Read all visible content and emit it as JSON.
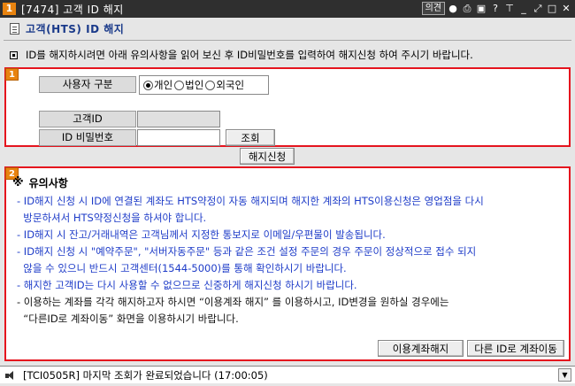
{
  "window": {
    "number": "1",
    "title": "[7474] 고객 ID 해지",
    "link_label": "의견",
    "icons": [
      "record-icon",
      "print-icon",
      "monitor-icon",
      "help-icon",
      "pin-icon",
      "minimize-icon",
      "expand-icon",
      "maximize-icon",
      "close-icon"
    ]
  },
  "header": {
    "title": "고객(HTS) ID 해지",
    "notice": "ID를 해지하시려면 아래 유의사항을 읽어 보신 후 ID비밀번호를 입력하여 해지신청 하여 주시기 바랍니다."
  },
  "section1": {
    "badge": "1",
    "user_type_label": "사용자 구분",
    "radio_options": [
      {
        "label": "개인",
        "selected": true
      },
      {
        "label": "법인",
        "selected": false
      },
      {
        "label": "외국인",
        "selected": false
      }
    ],
    "customer_id_label": "고객ID",
    "customer_id_value": "",
    "password_label": "ID 비밀번호",
    "password_value": "",
    "lookup_button": "조회"
  },
  "apply_button": "해지신청",
  "section2": {
    "badge": "2",
    "title": "유의사항",
    "items": [
      {
        "text": "- ID해지 신청 시 ID에 연결된 계좌도 HTS약정이 자동 해지되며 해지한 계좌의 HTS이용신청은 영업점을 다시",
        "color": "blue"
      },
      {
        "text": "  방문하셔서 HTS약정신청을 하셔야 합니다.",
        "color": "blue"
      },
      {
        "text": "- ID해지 시 잔고/거래내역은 고객님께서 지정한 통보지로 이메일/우편물이 발송됩니다.",
        "color": "blue"
      },
      {
        "text": "- ID해지 신청 시 \"예약주문\", \"서버자동주문\" 등과 같은 조건 설정 주문의 경우 주문이 정상적으로 접수 되지",
        "color": "blue"
      },
      {
        "text": "  않을 수 있으니 반드시 고객센터(1544-5000)를 통해 확인하시기 바랍니다.",
        "color": "blue"
      },
      {
        "text": "- 해지한 고객ID는 다시 사용할 수 없으므로 신중하게 해지신청 하시기 바랍니다.",
        "color": "blue"
      },
      {
        "text": "- 이용하는 계좌를 각각 해지하고자 하시면 “이용계좌 해지” 를 이용하시고, ID변경을 원하실 경우에는",
        "color": "black"
      },
      {
        "text": "  “다른ID로 계좌이동” 화면을 이용하시기 바랍니다.",
        "color": "black"
      }
    ],
    "account_cancel_button": "이용계좌해지",
    "move_account_button": "다른 ID로 계좌이동"
  },
  "status": {
    "message": "[TCI0505R] 마지막 조회가 완료되었습니다 (17:00:05)"
  }
}
